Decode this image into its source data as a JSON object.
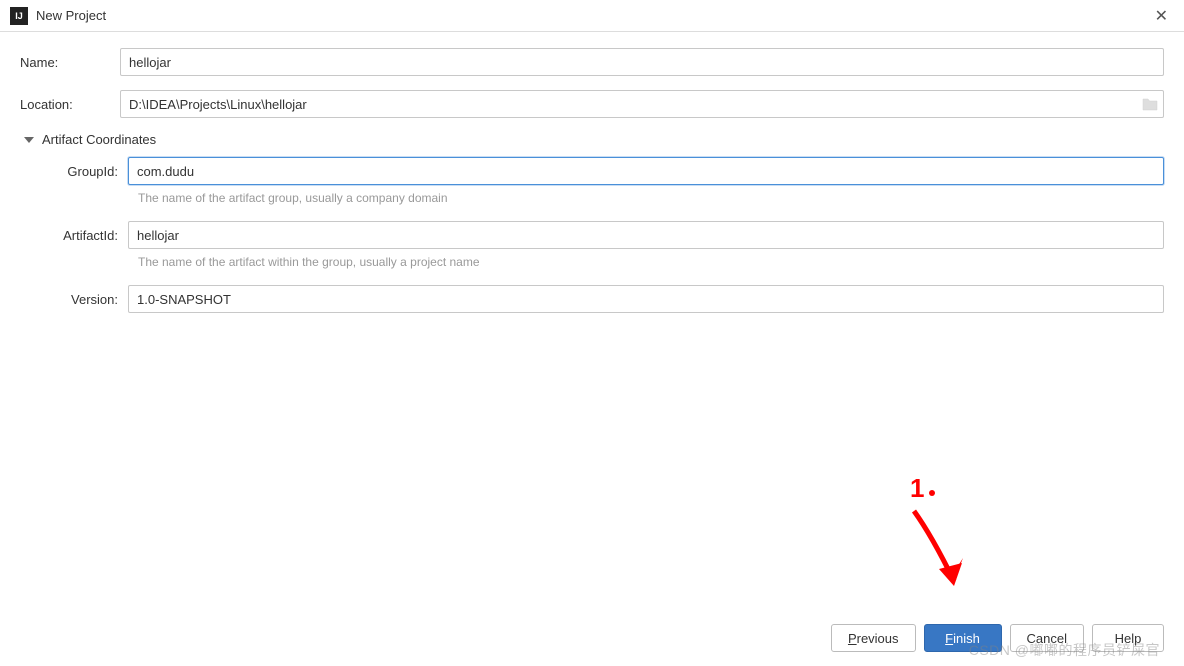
{
  "titlebar": {
    "title": "New Project",
    "icon_text": "IJ"
  },
  "form": {
    "name_label": "Name:",
    "name_value": "hellojar",
    "location_label": "Location:",
    "location_value": "D:\\IDEA\\Projects\\Linux\\hellojar"
  },
  "section": {
    "title": "Artifact Coordinates",
    "group_label": "GroupId:",
    "group_value": "com.dudu",
    "group_hint": "The name of the artifact group, usually a company domain",
    "artifact_label": "ArtifactId:",
    "artifact_value": "hellojar",
    "artifact_hint": "The name of the artifact within the group, usually a project name",
    "version_label": "Version:",
    "version_value": "1.0-SNAPSHOT"
  },
  "buttons": {
    "previous": "Previous",
    "finish": "Finish",
    "cancel": "Cancel",
    "help": "Help"
  },
  "watermark": "CSDN @嘟嘟的程序员铲屎官",
  "annotation": "1."
}
